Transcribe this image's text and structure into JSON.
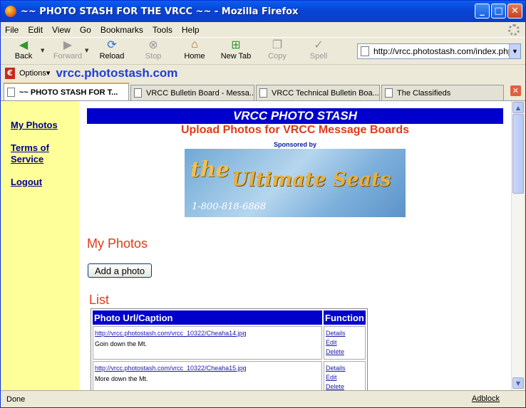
{
  "window": {
    "title": "~~ PHOTO STASH FOR THE VRCC ~~ - Mozilla Firefox",
    "minimize": "_",
    "maximize": "□",
    "close": "✕"
  },
  "menu": [
    "File",
    "Edit",
    "View",
    "Go",
    "Bookmarks",
    "Tools",
    "Help"
  ],
  "toolbar": {
    "back": "Back",
    "forward": "Forward",
    "reload": "Reload",
    "stop": "Stop",
    "home": "Home",
    "new_tab": "New Tab",
    "copy": "Copy",
    "spell": "Spell",
    "url": "http://vrcc.photostash.com/index.php"
  },
  "options_bar": {
    "label": "Options▾",
    "site": "vrcc.photostash.com"
  },
  "tabs": [
    {
      "label": "~~ PHOTO STASH FOR T..."
    },
    {
      "label": "VRCC Bulletin Board - Messa..."
    },
    {
      "label": "VRCC Technical Bulletin Boa..."
    },
    {
      "label": "The Classifieds"
    }
  ],
  "sidebar": {
    "my_photos": "My Photos",
    "terms": "Terms of Service",
    "logout": "Logout"
  },
  "page": {
    "banner": "VRCC PHOTO STASH",
    "subtitle": "Upload Photos for VRCC Message Boards",
    "sponsored": "Sponsored by",
    "ad": {
      "the": "the",
      "name": "Ultimate Seats",
      "phone": "1-800-818-6868"
    },
    "my_photos_heading": "My Photos",
    "add_button": "Add a photo",
    "list_heading": "List",
    "table": {
      "col_url": "Photo Url/Caption",
      "col_function": "Function",
      "rows": [
        {
          "url": "http://vrcc.photostash.com/vrcc_10322/Cheaha14.jpg",
          "caption": "Goin down the Mt.",
          "details": "Details",
          "edit": "Edit",
          "delete": "Delete"
        },
        {
          "url": "http://vrcc.photostash.com/vrcc_10322/Cheaha15.jpg",
          "caption": "More down the Mt.",
          "details": "Details",
          "edit": "Edit",
          "delete": "Delete"
        }
      ]
    }
  },
  "status": {
    "text": "Done",
    "adblock": "Adblock"
  }
}
